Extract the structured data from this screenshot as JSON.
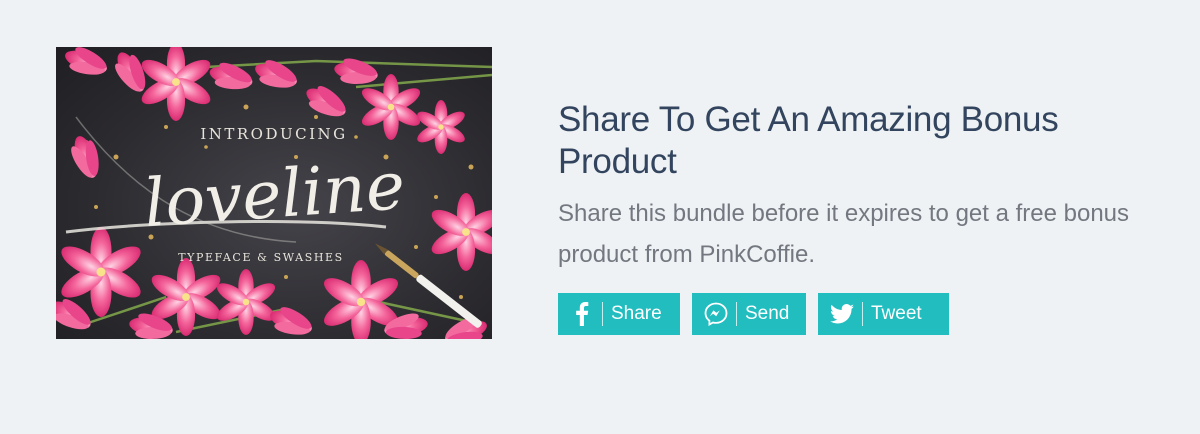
{
  "promo": {
    "image": {
      "intro_text": "INTRODUCING",
      "title_text": "loveline",
      "subtitle_text": "TYPEFACE & SWASHES"
    },
    "headline": "Share To Get An Amazing Bonus Product",
    "description": "Share this bundle before it expires to get a free bonus product from PinkCoffie.",
    "share_buttons": [
      {
        "label": "Share",
        "icon": "facebook-icon"
      },
      {
        "label": "Send",
        "icon": "messenger-icon"
      },
      {
        "label": "Tweet",
        "icon": "twitter-icon"
      }
    ]
  },
  "colors": {
    "background": "#eff2f5",
    "headline": "#33455e",
    "description": "#737880",
    "button": "#21bdbf",
    "flowers": "#f0508c"
  }
}
